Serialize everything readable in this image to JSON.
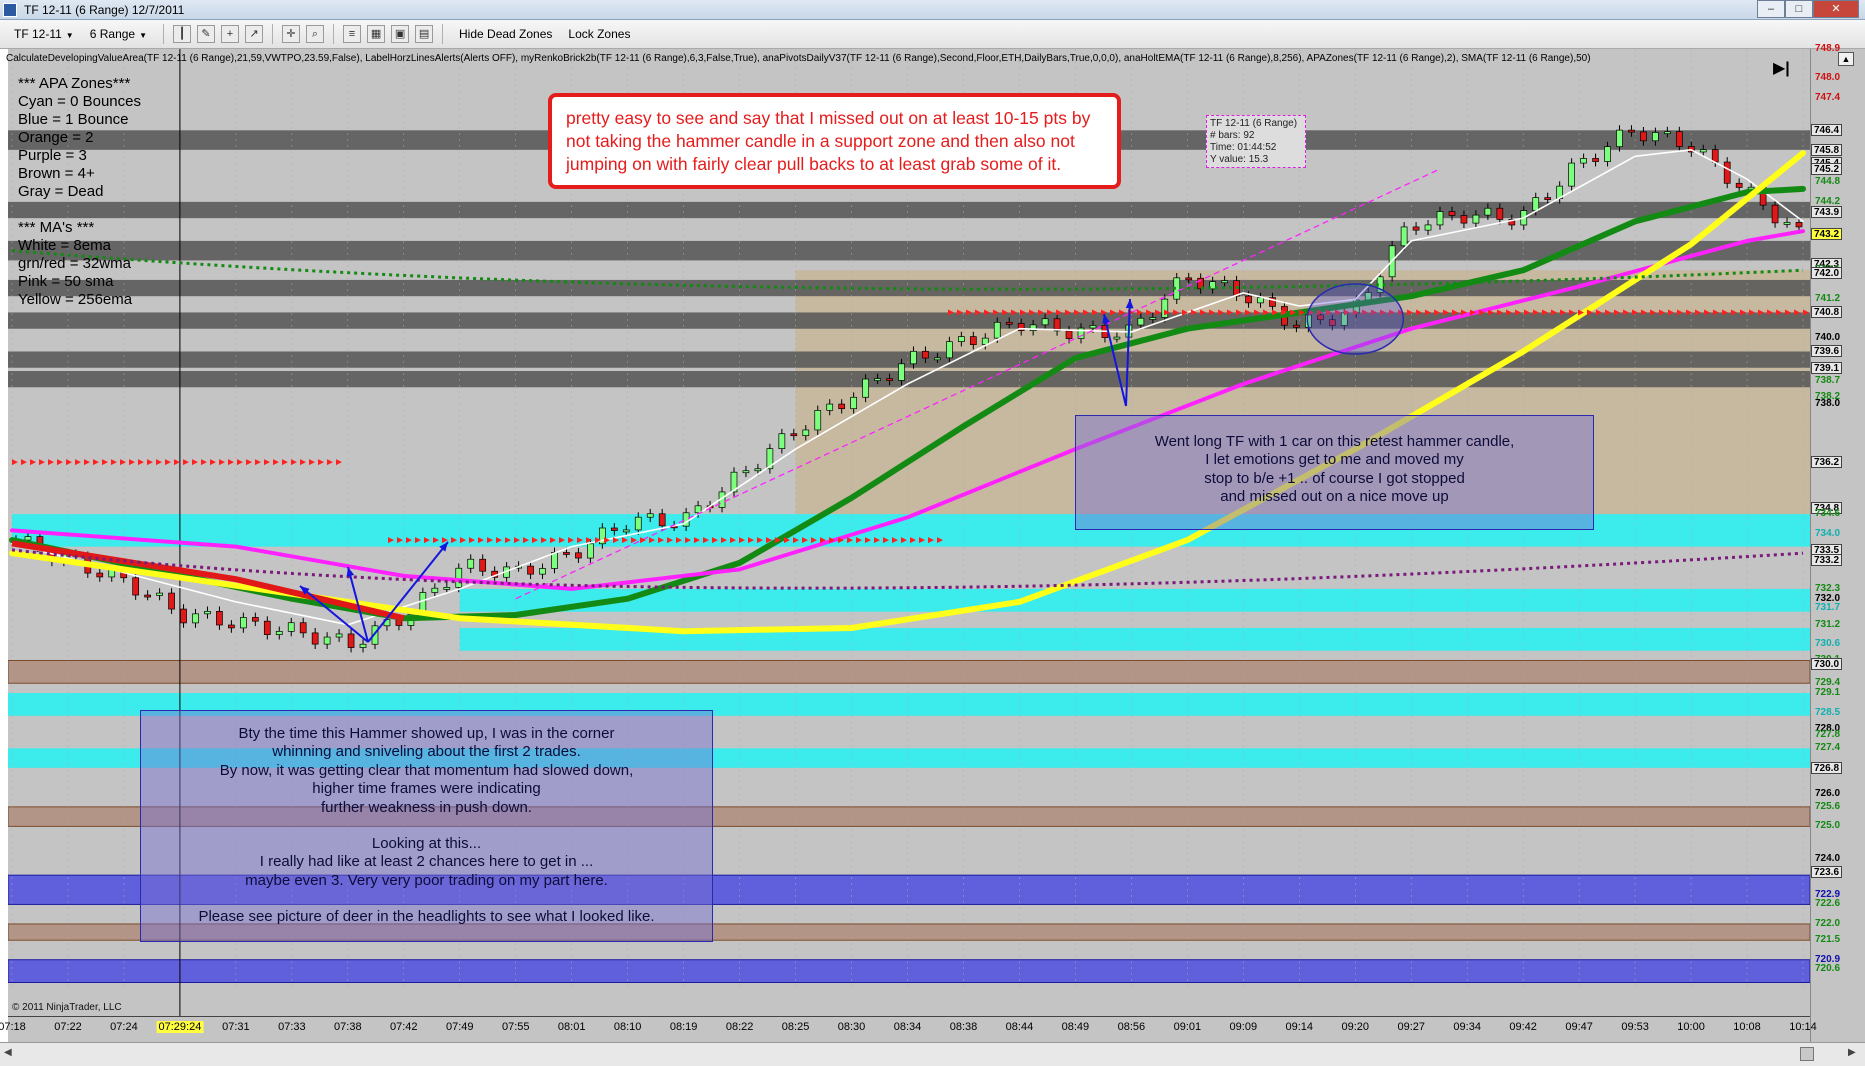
{
  "window": {
    "title": "TF 12-11 (6 Range)  12/7/2011"
  },
  "toolbar": {
    "instrument": "TF 12-11",
    "period": "6 Range",
    "hide_dead_zones": "Hide Dead Zones",
    "lock_zones": "Lock Zones"
  },
  "indicators_line": "CalculateDevelopingValueArea(TF 12-11 (6 Range),21,59,VWTPO,23.59,False), LabelHorzLinesAlerts(Alerts OFF), myRenkoBrick2b(TF 12-11 (6 Range),6,3,False,True), anaPivotsDailyV37(TF 12-11 (6 Range),Second,Floor,ETH,DailyBars,True,0,0,0), anaHoltEMA(TF 12-11 (6 Range),8,256), APAZones(TF 12-11 (6 Range),2), SMA(TF 12-11 (6 Range),50)",
  "legend": {
    "lines": [
      "***  APA Zones***",
      "Cyan = 0 Bounces",
      "Blue = 1 Bounce",
      "Orange = 2",
      "Purple = 3",
      "Brown = 4+",
      "Gray = Dead",
      "",
      "***   MA's   ***",
      "White = 8ema",
      "grn/red = 32wma",
      "Pink = 50 sma",
      "Yellow = 256ema"
    ]
  },
  "notes": {
    "main": [
      "pretty easy to see and say that I missed out on at least 10-15 pts by",
      "not taking the hammer candle in a support zone and then also not",
      "jumping on with fairly clear pull backs to at least grab some of it."
    ],
    "right": [
      "Went long TF with 1 car on this retest hammer candle,",
      "I let emotions get to me and moved my",
      "stop to b/e +1 .. of course I got stopped",
      "and missed out on a nice move up"
    ],
    "left": [
      "Bty the time this Hammer showed up, I was in the corner",
      "whinning and sniveling about the first 2 trades.",
      "By now, it was getting clear that momentum had slowed down,",
      "higher time frames were  indicating",
      "further weakness in push down.",
      "",
      "Looking at this...",
      "I really had like at least 2 chances here to get in ...",
      "maybe even 3. Very very poor trading on my part here.",
      "",
      "Please see picture of deer in the headlights to see what I looked like."
    ]
  },
  "databox": {
    "lines": [
      "TF 12-11 (6 Range)",
      "# bars:   92",
      "Time:     01:44:52",
      "Y value: 15.3"
    ]
  },
  "copyright": "© 2011 NinjaTrader, LLC",
  "colors": {
    "cyan_zone": "#2df0f0",
    "blue_zone": "#5555e0",
    "brown_zone": "#b09080",
    "gray_zone": "#555555",
    "tan_zone": "#c8b89c",
    "ema8": "#ffffff",
    "wma32": "#138a13",
    "sma50": "#ff22ff",
    "ema256": "#ffff1a"
  },
  "chart_data": {
    "type": "candlestick",
    "instrument": "TF 12-11 (6 Range)",
    "date": "12/7/2011",
    "x_ticks": [
      "07:18",
      "07:22",
      "07:24",
      "07:29:24",
      "07:31",
      "07:33",
      "07:38",
      "07:42",
      "07:49",
      "07:55",
      "08:01",
      "08:10",
      "08:19",
      "08:22",
      "08:25",
      "08:30",
      "08:34",
      "08:38",
      "08:44",
      "08:49",
      "08:56",
      "09:01",
      "09:09",
      "09:14",
      "09:20",
      "09:27",
      "09:34",
      "09:42",
      "09:47",
      "09:53",
      "10:00",
      "10:08",
      "10:14"
    ],
    "x_highlight": "07:29:24",
    "ylim": [
      720.0,
      748.9
    ],
    "y_ticks": [
      722.0,
      724.0,
      726.0,
      728.0,
      730.0,
      732.0,
      734.0,
      736.0,
      738.0,
      740.0,
      742.0,
      744.0,
      746.0,
      748.0
    ],
    "price_labels": [
      {
        "label": "748.9",
        "price": 748.9,
        "color": "#d01010"
      },
      {
        "label": "748.0",
        "price": 748.0,
        "color": "#d01010"
      },
      {
        "label": "747.4",
        "price": 747.4,
        "color": "#d01010"
      },
      {
        "label": "746.4",
        "price": 746.4,
        "color": "#000000",
        "boxed": true
      },
      {
        "label": "745.8",
        "price": 745.8,
        "color": "#000000",
        "boxed": true
      },
      {
        "label": "745.4",
        "price": 745.4,
        "color": "#000000",
        "boxed": true
      },
      {
        "label": "745.2",
        "price": 745.2,
        "color": "#000000",
        "boxed": true
      },
      {
        "label": "744.8",
        "price": 744.8,
        "color": "#138a13"
      },
      {
        "label": "744.2",
        "price": 744.2,
        "color": "#138a13"
      },
      {
        "label": "743.9",
        "price": 743.9,
        "color": "#000000",
        "boxed": true
      },
      {
        "label": "743.2",
        "price": 743.2,
        "color": "#000000",
        "highlight": true
      },
      {
        "label": "742.3",
        "price": 742.3,
        "color": "#000000",
        "boxed": true
      },
      {
        "label": "742.1",
        "price": 742.1,
        "color": "#138a13"
      },
      {
        "label": "742.0",
        "price": 742.0,
        "color": "#000000",
        "boxed": true
      },
      {
        "label": "741.2",
        "price": 741.2,
        "color": "#138a13"
      },
      {
        "label": "740.8",
        "price": 740.8,
        "color": "#000000",
        "boxed": true
      },
      {
        "label": "740.0",
        "price": 740.0,
        "color": "#000000"
      },
      {
        "label": "739.6",
        "price": 739.6,
        "color": "#000000",
        "boxed": true
      },
      {
        "label": "739.1",
        "price": 739.1,
        "color": "#000000",
        "boxed": true
      },
      {
        "label": "738.7",
        "price": 738.7,
        "color": "#138a13"
      },
      {
        "label": "738.2",
        "price": 738.2,
        "color": "#138a13"
      },
      {
        "label": "738.0",
        "price": 738.0,
        "color": "#000000"
      },
      {
        "label": "736.2",
        "price": 736.2,
        "color": "#000000",
        "boxed": true
      },
      {
        "label": "734.8",
        "price": 734.8,
        "color": "#000000",
        "boxed": true
      },
      {
        "label": "734.6",
        "price": 734.6,
        "color": "#138a13"
      },
      {
        "label": "734.0",
        "price": 734.0,
        "color": "#10b0b0"
      },
      {
        "label": "733.5",
        "price": 733.5,
        "color": "#000000",
        "boxed": true
      },
      {
        "label": "733.2",
        "price": 733.2,
        "color": "#000000",
        "boxed": true
      },
      {
        "label": "732.3",
        "price": 732.3,
        "color": "#138a13"
      },
      {
        "label": "732.0",
        "price": 732.0,
        "color": "#000000"
      },
      {
        "label": "731.7",
        "price": 731.7,
        "color": "#10b0b0"
      },
      {
        "label": "731.2",
        "price": 731.2,
        "color": "#138a13"
      },
      {
        "label": "730.6",
        "price": 730.6,
        "color": "#10b0b0"
      },
      {
        "label": "730.1",
        "price": 730.1,
        "color": "#138a13"
      },
      {
        "label": "730.0",
        "price": 730.0,
        "color": "#000000",
        "boxed": true
      },
      {
        "label": "729.4",
        "price": 729.4,
        "color": "#138a13"
      },
      {
        "label": "729.1",
        "price": 729.1,
        "color": "#138a13"
      },
      {
        "label": "728.5",
        "price": 728.5,
        "color": "#10b0b0"
      },
      {
        "label": "728.0",
        "price": 728.0,
        "color": "#000000"
      },
      {
        "label": "727.8",
        "price": 727.8,
        "color": "#138a13"
      },
      {
        "label": "727.4",
        "price": 727.4,
        "color": "#138a13"
      },
      {
        "label": "726.8",
        "price": 726.8,
        "color": "#10b0b0"
      },
      {
        "label": "726.8",
        "price": 726.8,
        "color": "#000000",
        "boxed": true
      },
      {
        "label": "726.0",
        "price": 726.0,
        "color": "#000000"
      },
      {
        "label": "725.6",
        "price": 725.6,
        "color": "#138a13"
      },
      {
        "label": "725.0",
        "price": 725.0,
        "color": "#138a13"
      },
      {
        "label": "724.0",
        "price": 724.0,
        "color": "#000000"
      },
      {
        "label": "723.5",
        "price": 723.5,
        "color": "#138a13"
      },
      {
        "label": "723.6",
        "price": 723.6,
        "color": "#000000",
        "boxed": true
      },
      {
        "label": "722.9",
        "price": 722.9,
        "color": "#1010b0"
      },
      {
        "label": "722.6",
        "price": 722.6,
        "color": "#138a13"
      },
      {
        "label": "722.0",
        "price": 722.0,
        "color": "#138a13"
      },
      {
        "label": "721.5",
        "price": 721.5,
        "color": "#138a13"
      },
      {
        "label": "720.9",
        "price": 720.9,
        "color": "#1010b0"
      },
      {
        "label": "720.6",
        "price": 720.6,
        "color": "#138a13"
      }
    ],
    "zones": [
      {
        "kind": "gray",
        "from": 745.8,
        "to": 746.4
      },
      {
        "kind": "gray",
        "from": 743.7,
        "to": 744.2
      },
      {
        "kind": "gray",
        "from": 742.4,
        "to": 743.0
      },
      {
        "kind": "gray",
        "from": 741.3,
        "to": 741.8
      },
      {
        "kind": "gray",
        "from": 740.3,
        "to": 740.8
      },
      {
        "kind": "gray",
        "from": 739.1,
        "to": 739.6
      },
      {
        "kind": "gray",
        "from": 738.5,
        "to": 739.0
      },
      {
        "kind": "tan",
        "from": 734.6,
        "to": 742.1
      },
      {
        "kind": "cyan",
        "from": 733.6,
        "to": 734.6
      },
      {
        "kind": "cyan",
        "from": 731.6,
        "to": 732.3
      },
      {
        "kind": "cyan",
        "from": 730.4,
        "to": 731.1
      },
      {
        "kind": "brown",
        "from": 729.4,
        "to": 730.1
      },
      {
        "kind": "cyan",
        "from": 728.4,
        "to": 729.1
      },
      {
        "kind": "cyan",
        "from": 726.8,
        "to": 727.4
      },
      {
        "kind": "brown",
        "from": 725.0,
        "to": 725.6
      },
      {
        "kind": "blue",
        "from": 722.6,
        "to": 723.5
      },
      {
        "kind": "brown",
        "from": 721.5,
        "to": 722.0
      },
      {
        "kind": "blue",
        "from": 720.2,
        "to": 720.9
      }
    ],
    "price_path": [
      [
        "07:18",
        733.8
      ],
      [
        "07:24",
        732.5
      ],
      [
        "07:29:24",
        731.5
      ],
      [
        "07:33",
        731.0
      ],
      [
        "07:38",
        730.6
      ],
      [
        "07:42",
        731.5
      ],
      [
        "07:49",
        733.0
      ],
      [
        "07:55",
        732.8
      ],
      [
        "08:01",
        733.4
      ],
      [
        "08:10",
        734.4
      ],
      [
        "08:19",
        734.4
      ],
      [
        "08:25",
        737.2
      ],
      [
        "08:34",
        739.3
      ],
      [
        "08:44",
        740.5
      ],
      [
        "08:49",
        740.2
      ],
      [
        "08:56",
        740.2
      ],
      [
        "09:01",
        741.9
      ],
      [
        "09:09",
        741.4
      ],
      [
        "09:14",
        740.4
      ],
      [
        "09:20",
        740.8
      ],
      [
        "09:27",
        743.5
      ],
      [
        "09:34",
        743.8
      ],
      [
        "09:42",
        743.7
      ],
      [
        "09:47",
        745.3
      ],
      [
        "09:53",
        746.4
      ],
      [
        "10:00",
        746.0
      ],
      [
        "10:08",
        744.6
      ],
      [
        "10:14",
        743.2
      ]
    ],
    "series": [
      {
        "name": "White = 8ema",
        "values": [
          [
            0,
            733.7
          ],
          [
            4,
            731.9
          ],
          [
            6,
            731.2
          ],
          [
            8,
            732.3
          ],
          [
            10,
            733.6
          ],
          [
            12,
            734.3
          ],
          [
            14,
            736.6
          ],
          [
            16,
            738.6
          ],
          [
            18,
            740.3
          ],
          [
            20,
            740.2
          ],
          [
            22,
            741.4
          ],
          [
            23,
            741.0
          ],
          [
            24,
            741.2
          ],
          [
            25,
            743.0
          ],
          [
            27,
            743.7
          ],
          [
            29,
            745.6
          ],
          [
            30,
            745.8
          ],
          [
            31,
            744.9
          ],
          [
            32,
            743.6
          ]
        ]
      },
      {
        "name": "grn/red = 32wma",
        "values": [
          [
            0,
            733.8
          ],
          [
            5,
            732.0
          ],
          [
            7,
            731.4
          ],
          [
            9,
            731.5
          ],
          [
            11,
            732.0
          ],
          [
            13,
            733.1
          ],
          [
            15,
            735.1
          ],
          [
            17,
            737.3
          ],
          [
            19,
            739.4
          ],
          [
            21,
            740.3
          ],
          [
            23,
            740.8
          ],
          [
            25,
            741.3
          ],
          [
            27,
            742.1
          ],
          [
            29,
            743.6
          ],
          [
            31,
            744.5
          ],
          [
            32,
            744.6
          ]
        ]
      },
      {
        "name": "Pink = 50 sma",
        "values": [
          [
            0,
            734.1
          ],
          [
            4,
            733.6
          ],
          [
            7,
            732.7
          ],
          [
            10,
            732.3
          ],
          [
            13,
            732.9
          ],
          [
            16,
            734.5
          ],
          [
            19,
            736.6
          ],
          [
            22,
            738.6
          ],
          [
            25,
            740.3
          ],
          [
            28,
            741.6
          ],
          [
            31,
            743.0
          ],
          [
            32,
            743.3
          ]
        ]
      },
      {
        "name": "Yellow = 256ema",
        "values": [
          [
            0,
            733.4
          ],
          [
            4,
            732.4
          ],
          [
            8,
            731.4
          ],
          [
            12,
            731.0
          ],
          [
            15,
            731.1
          ],
          [
            18,
            731.9
          ],
          [
            21,
            733.8
          ],
          [
            24,
            736.6
          ],
          [
            27,
            739.6
          ],
          [
            30,
            742.9
          ],
          [
            32,
            745.7
          ]
        ]
      }
    ]
  }
}
